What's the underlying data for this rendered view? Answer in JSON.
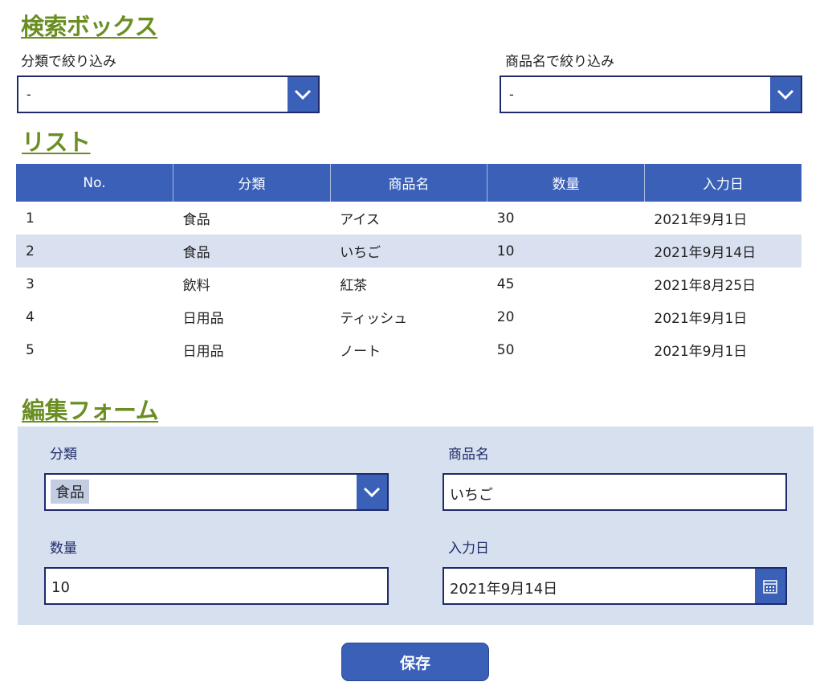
{
  "search": {
    "title": "検索ボックス",
    "category_filter": {
      "label": "分類で絞り込み",
      "value": "-"
    },
    "product_filter": {
      "label": "商品名で絞り込み",
      "value": "-"
    }
  },
  "list": {
    "title": "リスト",
    "columns": [
      "No.",
      "分類",
      "商品名",
      "数量",
      "入力日"
    ],
    "rows": [
      [
        "1",
        "食品",
        "アイス",
        "30",
        "2021年9月1日"
      ],
      [
        "2",
        "食品",
        "いちご",
        "10",
        "2021年9月14日"
      ],
      [
        "3",
        "飲料",
        "紅茶",
        "45",
        "2021年8月25日"
      ],
      [
        "4",
        "日用品",
        "ティッシュ",
        "20",
        "2021年9月1日"
      ],
      [
        "5",
        "日用品",
        "ノート",
        "50",
        "2021年9月1日"
      ]
    ],
    "selected_row": 2
  },
  "form": {
    "title": "編集フォーム",
    "category": {
      "label": "分類",
      "value": "食品"
    },
    "product": {
      "label": "商品名",
      "value": "いちご"
    },
    "quantity": {
      "label": "数量",
      "value": "10"
    },
    "date": {
      "label": "入力日",
      "value": "2021年9月14日"
    }
  },
  "actions": {
    "save_label": "保存"
  },
  "colors": {
    "accent": "#3a60b8",
    "heading": "#6b8e23",
    "border": "#1f2a6b",
    "panel": "#d6e0ef",
    "selected_row": "#d9e0f0"
  },
  "icons": {
    "dropdown": "chevron-down-icon",
    "date": "calendar-icon"
  }
}
